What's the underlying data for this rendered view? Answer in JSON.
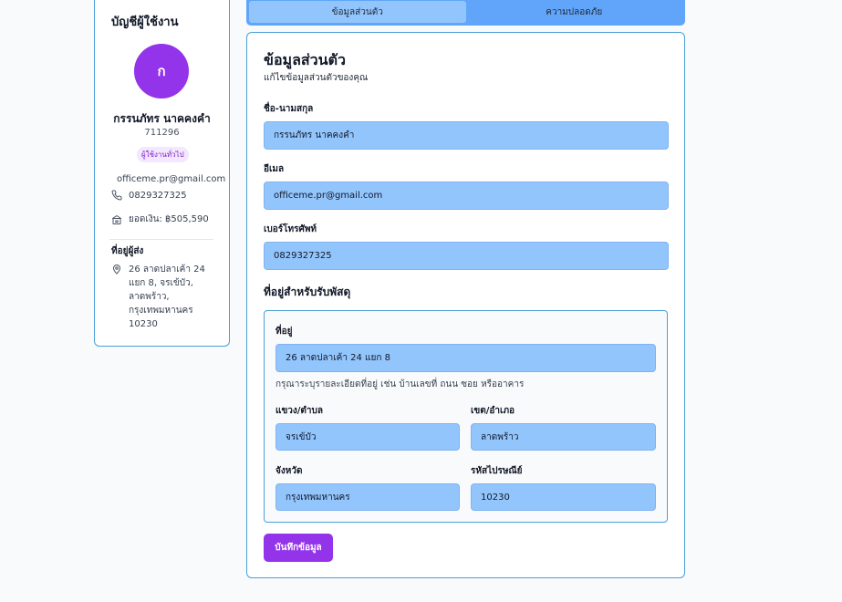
{
  "profile": {
    "title": "บัญชีผู้ใช้งาน",
    "avatar_initial": "ก",
    "name": "กรรนภัทร นาคคงคำ",
    "user_id": "711296",
    "role_badge": "ผู้ใช้งานทั่วไป",
    "email": "officeme.pr@gmail.com",
    "phone": "0829327325",
    "balance": "ยอดเงิน: ฿505,590",
    "address_title": "ที่อยู่ผู้ส่ง",
    "address_lines": [
      "26 ลาดปลาเค้า 24",
      "แยก 8, จรเข้บัว,",
      "ลาดพร้าว,",
      "กรุงเทพมหานคร",
      "10230"
    ],
    "icons": {
      "phone": "phone-icon",
      "wallet": "wallet-icon",
      "location": "location-pin-icon"
    }
  },
  "tabs": [
    {
      "label": "ข้อมูลส่วนตัว",
      "active": true
    },
    {
      "label": "ความปลอดภัย",
      "active": false
    }
  ],
  "form": {
    "title": "ข้อมูลส่วนตัว",
    "subtitle": "แก้ไขข้อมูลส่วนตัวของคุณ",
    "fullname_label": "ชื่อ-นามสกุล",
    "fullname_value": "กรรนภัทร นาคคงคำ",
    "email_label": "อีเมล",
    "email_value": "officeme.pr@gmail.com",
    "phone_label": "เบอร์โทรศัพท์",
    "phone_value": "0829327325",
    "shipping_title": "ที่อยู่สำหรับรับพัสดุ",
    "address_label": "ที่อยู่",
    "address_value": "26 ลาดปลาเค้า 24 แยก 8",
    "address_hint": "กรุณาระบุรายละเอียดที่อยู่ เช่น บ้านเลขที่ ถนน ซอย หรืออาคาร",
    "subdistrict_label": "แขวง/ตำบล",
    "subdistrict_value": "จรเข้บัว",
    "district_label": "เขต/อำเภอ",
    "district_value": "ลาดพร้าว",
    "province_label": "จังหวัด",
    "province_value": "กรุงเทพมหานคร",
    "postcode_label": "รหัสไปรษณีย์",
    "postcode_value": "10230",
    "save_label": "บันทึกข้อมูล"
  },
  "colors": {
    "accent": "#9333ea",
    "input_bg": "#93c5fd",
    "tab_bar": "#60a5fa",
    "border": "#4a9fd8"
  }
}
